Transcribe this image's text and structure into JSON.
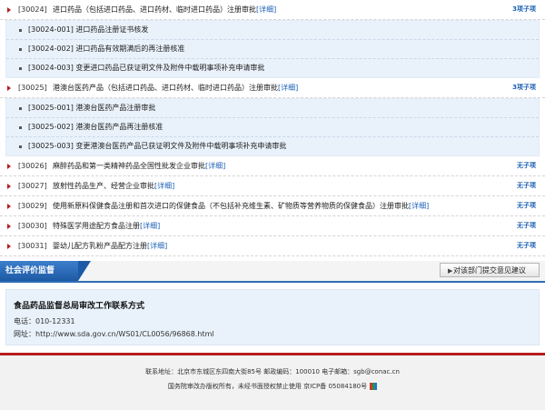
{
  "items": [
    {
      "code": "[30024]",
      "title": "进口药品（包括进口药品、进口药材、临时进口药品）注册审批",
      "detail": "[详细]",
      "count": "3项子项",
      "subs": [
        "[30024-001] 进口药品注册证书核发",
        "[30024-002] 进口药品有效期满后的再注册核准",
        "[30024-003] 变更进口药品已获证明文件及附件中载明事项补充申请审批"
      ]
    },
    {
      "code": "[30025]",
      "title": "港澳台医药产品（包括进口药品、进口药材、临时进口药品）注册审批",
      "detail": "[详细]",
      "count": "3项子项",
      "subs": [
        "[30025-001] 港澳台医药产品注册审批",
        "[30025-002] 港澳台医药产品再注册核准",
        "[30025-003] 变更港澳台医药产品已获证明文件及附件中载明事项补充申请审批"
      ]
    },
    {
      "code": "[30026]",
      "title": "麻醉药品和第一类精神药品全国性批发企业审批",
      "detail": "[详细]",
      "count": "无子项"
    },
    {
      "code": "[30027]",
      "title": "放射性药品生产、经营企业审批",
      "detail": "[详细]",
      "count": "无子项"
    },
    {
      "code": "[30029]",
      "title": "使用新原料保健食品注册和首次进口的保健食品（不包括补充维生素、矿物质等营养物质的保健食品）注册审批",
      "detail": "[详细]",
      "count": "无子项"
    },
    {
      "code": "[30030]",
      "title": "特殊医学用途配方食品注册",
      "detail": "[详细]",
      "count": "无子项"
    },
    {
      "code": "[30031]",
      "title": "婴幼儿配方乳粉产品配方注册",
      "detail": "[详细]",
      "count": "无子项"
    }
  ],
  "section": {
    "tab": "社会评价监督",
    "button": "对该部门提交意见建议",
    "button_arrow": "▶"
  },
  "contact": {
    "title": "食品药品监督总局审改工作联系方式",
    "phone": "电话：010-12331",
    "url": "网址：http://www.sda.gov.cn/WS01/CL0056/96868.html"
  },
  "footer": {
    "line1": "联系地址：北京市东城区东四南大街85号  邮政编码：100010  电子邮箱：sgb@conac.cn",
    "line2": "国务院审改办版权所有，未经书面授权禁止使用  京ICP备 05084180号"
  },
  "colors": {
    "accent_blue": "#2f6db5",
    "accent_red": "#b71c1c",
    "sub_bg": "#e9f2fb"
  }
}
